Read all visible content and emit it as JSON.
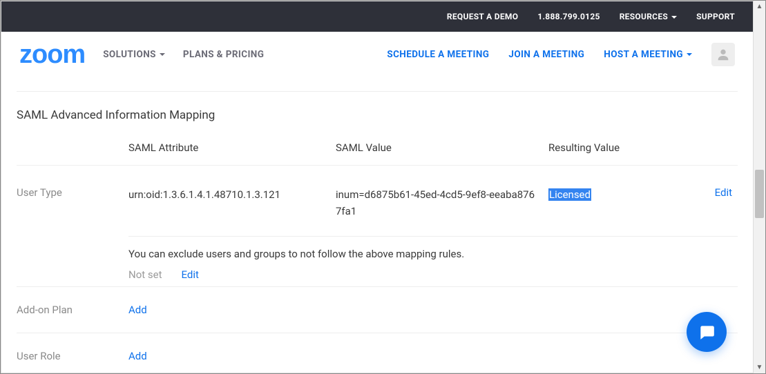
{
  "topbar": {
    "demo": "REQUEST A DEMO",
    "phone": "1.888.799.0125",
    "resources": "RESOURCES",
    "support": "SUPPORT"
  },
  "nav": {
    "logo": "zoom",
    "solutions": "SOLUTIONS",
    "plans": "PLANS & PRICING",
    "schedule": "SCHEDULE A MEETING",
    "join": "JOIN A MEETING",
    "host": "HOST A MEETING"
  },
  "section": {
    "title": "SAML Advanced Information Mapping"
  },
  "headers": {
    "attr": "SAML Attribute",
    "value": "SAML Value",
    "result": "Resulting Value"
  },
  "rows": {
    "userType": {
      "label": "User Type",
      "attr": "urn:oid:1.3.6.1.4.1.48710.1.3.121",
      "value": "inum=d6875b61-45ed-4cd5-9ef8-eeaba8767fa1",
      "result": "Licensed",
      "edit": "Edit",
      "excludeText": "You can exclude users and groups to not follow the above mapping rules.",
      "notSet": "Not set",
      "excludeEdit": "Edit"
    },
    "addonPlan": {
      "label": "Add-on Plan",
      "action": "Add"
    },
    "userRole": {
      "label": "User Role",
      "action": "Add"
    }
  }
}
